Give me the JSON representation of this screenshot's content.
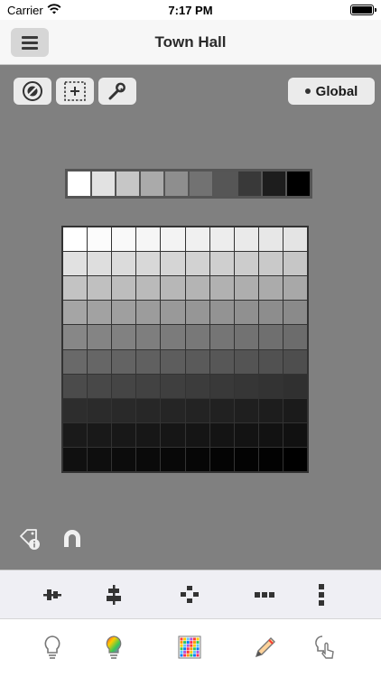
{
  "status_bar": {
    "carrier": "Carrier",
    "time": "7:17 PM"
  },
  "nav": {
    "title": "Town Hall",
    "menu_icon": "hamburger-menu-icon"
  },
  "tools": {
    "items": [
      {
        "name": "no-selection-icon"
      },
      {
        "name": "add-selection-icon"
      },
      {
        "name": "wrench-icon"
      }
    ],
    "scope_label": "Global"
  },
  "palette": {
    "colors": [
      "#ffffff",
      "#e2e2e2",
      "#c6c6c6",
      "#aaaaaa",
      "#8e8e8e",
      "#727272",
      "#565656",
      "#393939",
      "#1d1d1d",
      "#000000"
    ]
  },
  "color_grid": {
    "rows": [
      [
        "#ffffff",
        "#fcfcfc",
        "#f9f9f9",
        "#f6f6f6",
        "#f3f3f3",
        "#f0f0f0",
        "#ededed",
        "#eaeaea",
        "#e7e7e7",
        "#e4e4e4"
      ],
      [
        "#e1e1e1",
        "#dedede",
        "#dbdbdb",
        "#d8d8d8",
        "#d5d5d5",
        "#d2d2d2",
        "#cfcfcf",
        "#cccccc",
        "#c9c9c9",
        "#c6c6c6"
      ],
      [
        "#c3c3c3",
        "#c0c0c0",
        "#bdbdbd",
        "#bababa",
        "#b7b7b7",
        "#b4b4b4",
        "#b1b1b1",
        "#aeaeae",
        "#ababab",
        "#a8a8a8"
      ],
      [
        "#a5a5a5",
        "#a2a2a2",
        "#9f9f9f",
        "#9c9c9c",
        "#999999",
        "#969696",
        "#939393",
        "#909090",
        "#8d8d8d",
        "#8a8a8a"
      ],
      [
        "#878787",
        "#848484",
        "#818181",
        "#7e7e7e",
        "#7b7b7b",
        "#787878",
        "#757575",
        "#727272",
        "#6f6f6f",
        "#6c6c6c"
      ],
      [
        "#696969",
        "#666666",
        "#636363",
        "#606060",
        "#5d5d5d",
        "#5a5a5a",
        "#575757",
        "#545454",
        "#515151",
        "#4e4e4e"
      ],
      [
        "#4b4b4b",
        "#484848",
        "#454545",
        "#424242",
        "#3f3f3f",
        "#3c3c3c",
        "#393939",
        "#363636",
        "#333333",
        "#303030"
      ],
      [
        "#2d2d2d",
        "#2b2b2b",
        "#292929",
        "#272727",
        "#252525",
        "#232323",
        "#212121",
        "#1f1f1f",
        "#1d1d1d",
        "#1b1b1b"
      ],
      [
        "#1a1a1a",
        "#191919",
        "#181818",
        "#171717",
        "#161616",
        "#151515",
        "#141414",
        "#131313",
        "#121212",
        "#111111"
      ],
      [
        "#101010",
        "#0e0e0e",
        "#0c0c0c",
        "#0a0a0a",
        "#080808",
        "#060606",
        "#040404",
        "#030303",
        "#020202",
        "#000000"
      ]
    ]
  },
  "bottom_left_icons": [
    "tag-info-icon",
    "magnet-icon"
  ],
  "toolbar": {
    "items": [
      "align-center-vertical-icon",
      "align-center-horizontal-icon",
      "distribute-grid-icon",
      "more-horizontal-icon",
      "more-vertical-icon"
    ]
  },
  "tabbar": {
    "items": [
      "bulb-icon",
      "color-bulb-icon",
      "color-grid-icon",
      "pencil-icon",
      "touch-bulb-icon"
    ]
  }
}
